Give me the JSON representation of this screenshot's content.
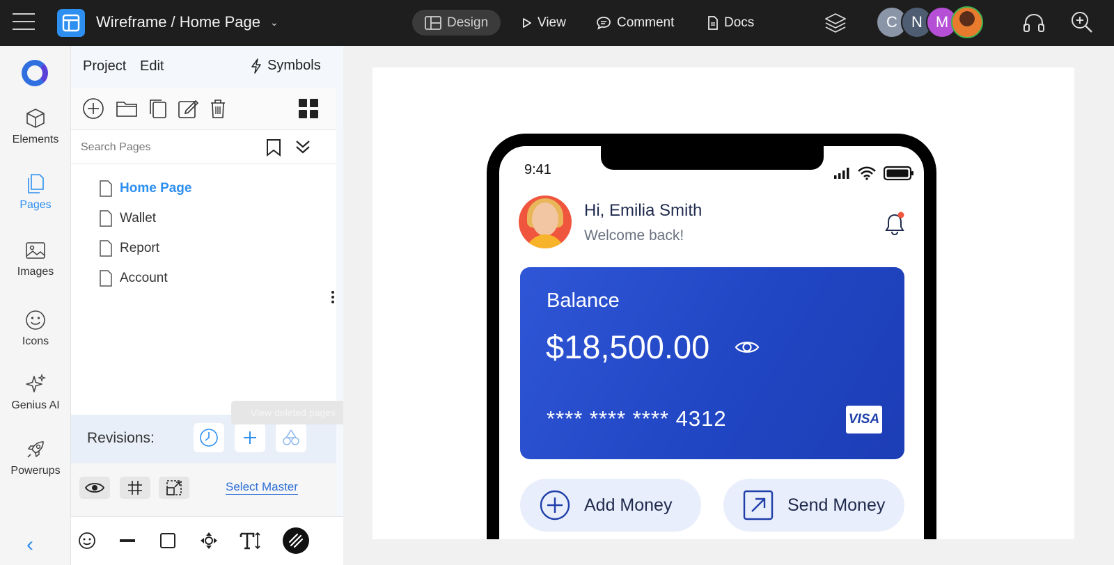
{
  "app": {
    "breadcrumb": "Wireframe / Home Page",
    "tabs": [
      {
        "label": "Design",
        "active": true
      },
      {
        "label": "View",
        "active": false
      },
      {
        "label": "Comment",
        "active": false
      },
      {
        "label": "Docs",
        "active": false
      }
    ],
    "collaborators": [
      {
        "initial": "C",
        "color": "#8a96a8"
      },
      {
        "initial": "N",
        "color": "#5a6a80"
      },
      {
        "initial": "M",
        "color": "#b44fd6"
      }
    ],
    "icons": {
      "menu": "hamburger-icon",
      "logo": "wireframe-logo-icon",
      "layers": "layers-icon",
      "headset": "headset-icon",
      "zoom": "zoom-in-icon"
    }
  },
  "rail": {
    "items": [
      {
        "label": "Elements",
        "icon": "cube-icon"
      },
      {
        "label": "Pages",
        "icon": "pages-icon",
        "active": true
      },
      {
        "label": "Images",
        "icon": "image-icon"
      },
      {
        "label": "Icons",
        "icon": "smiley-icon"
      },
      {
        "label": "Genius AI",
        "icon": "sparkle-icon"
      },
      {
        "label": "Powerups",
        "icon": "rocket-icon"
      }
    ]
  },
  "panel": {
    "menu": [
      "Project",
      "Edit"
    ],
    "symbols_label": "Symbols",
    "search_placeholder": "Search Pages",
    "pages": [
      {
        "label": "Home Page",
        "active": true
      },
      {
        "label": "Wallet"
      },
      {
        "label": "Report"
      },
      {
        "label": "Account"
      }
    ],
    "tooltip": "View deleted pages",
    "revisions_label": "Revisions:",
    "select_master": "Select Master"
  },
  "mobile": {
    "time": "9:41",
    "greeting": "Hi, Emilia Smith",
    "welcome": "Welcome back!",
    "card": {
      "label": "Balance",
      "amount": "$18,500.00",
      "number": "**** **** **** 4312",
      "brand": "VISA"
    },
    "actions": [
      "Add Money",
      "Send Money"
    ],
    "colors": {
      "card": "#2146c4",
      "pill": "#e8eefb",
      "accent": "#2d8ff0"
    }
  }
}
